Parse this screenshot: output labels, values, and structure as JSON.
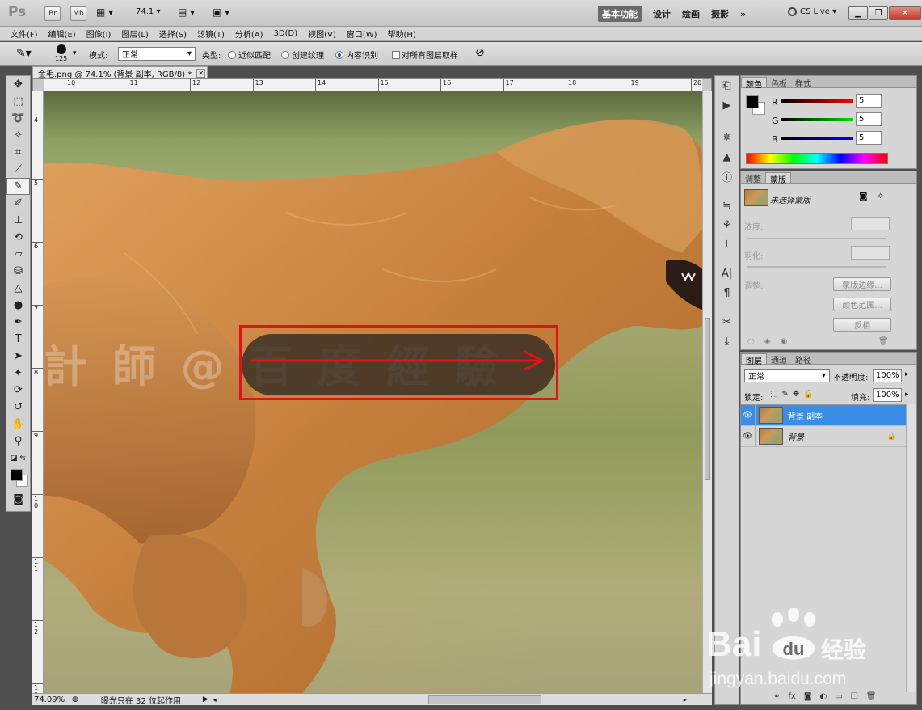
{
  "titlebar": {
    "logo": "Ps",
    "bridge_label": "Br",
    "minibridge_label": "Mb",
    "zoom_value": "74.1",
    "workspaces": [
      "基本功能",
      "设计",
      "绘画",
      "摄影"
    ],
    "more": "»",
    "cslive": "CS Live"
  },
  "menubar": [
    "文件(F)",
    "编辑(E)",
    "图像(I)",
    "图层(L)",
    "选择(S)",
    "滤镜(T)",
    "分析(A)",
    "3D(D)",
    "视图(V)",
    "窗口(W)",
    "帮助(H)"
  ],
  "options": {
    "brush_size": "125",
    "mode_label": "模式:",
    "mode_value": "正常",
    "type_label": "类型:",
    "type_options": [
      "近似匹配",
      "创建纹理",
      "内容识别"
    ],
    "type_selected": "内容识别",
    "sample_all_label": "对所有图层取样"
  },
  "document": {
    "tab_title": "金毛.png @ 74.1% (背景 副本, RGB/8) *",
    "ruler_top": [
      "10",
      "11",
      "12",
      "13",
      "14",
      "15",
      "16",
      "17",
      "18",
      "19",
      "20"
    ],
    "ruler_left": [
      "4",
      "5",
      "6",
      "7",
      "8",
      "9",
      "1 0",
      "1 1",
      "1 2",
      "1 3"
    ],
    "watermark_text": "計 師 @ 百 度 經 驗",
    "highlight_color": "#e4101b",
    "zoom_status": "74.09%",
    "status_message": "曝光只在 32 位起作用"
  },
  "color_panel": {
    "tabs": [
      "颜色",
      "色板",
      "样式"
    ],
    "r_label": "R",
    "r_value": "5",
    "g_label": "G",
    "g_value": "5",
    "b_label": "B",
    "b_value": "5"
  },
  "mask_panel": {
    "tabs": [
      "调整",
      "蒙版"
    ],
    "no_mask_label": "未选择蒙版",
    "density_label": "浓度:",
    "feather_label": "羽化:",
    "refine_label": "调整:",
    "mask_edge_button": "蒙版边缘...",
    "color_range_button": "颜色范围...",
    "invert_button": "反相"
  },
  "layers_panel": {
    "tabs": [
      "图层",
      "通道",
      "路径"
    ],
    "blend_mode": "正常",
    "opacity_label": "不透明度:",
    "opacity_value": "100%",
    "lock_label": "锁定:",
    "fill_label": "填充:",
    "fill_value": "100%",
    "layers": [
      {
        "name": "背景 副本",
        "selected": true
      },
      {
        "name": "背景",
        "selected": false
      }
    ]
  },
  "watermark": {
    "brand": "Bai",
    "brand_cn": "经验",
    "url": "jingyan.baidu.com"
  }
}
